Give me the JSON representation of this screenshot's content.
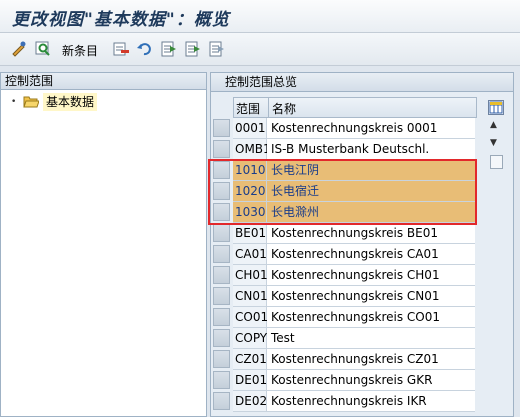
{
  "title": "更改视图\"基本数据\"：概览",
  "toolbar": {
    "new_entries_label": "新条目",
    "icons": [
      "display-change-icon",
      "find-icon",
      "copy-icon",
      "delete-icon",
      "undo-icon",
      "select-all-icon",
      "select-block-icon",
      "deselect-all-icon"
    ]
  },
  "left_pane": {
    "header": "控制范围",
    "tree_item": "基本数据"
  },
  "right_pane": {
    "header": "控制范围总览",
    "columns": [
      "范围",
      "名称"
    ],
    "rows": [
      {
        "code": "0001",
        "name": "Kostenrechnungskreis 0001"
      },
      {
        "code": "OMB1",
        "name": "IS-B Musterbank Deutschl."
      },
      {
        "code": "1010",
        "name": "长电江阴"
      },
      {
        "code": "1020",
        "name": "长电宿迁"
      },
      {
        "code": "1030",
        "name": "长电滁州"
      },
      {
        "code": "BE01",
        "name": "Kostenrechnungskreis BE01"
      },
      {
        "code": "CA01",
        "name": "Kostenrechnungskreis CA01"
      },
      {
        "code": "CH01",
        "name": "Kostenrechnungskreis CH01"
      },
      {
        "code": "CN01",
        "name": "Kostenrechnungskreis CN01"
      },
      {
        "code": "CO01",
        "name": "Kostenrechnungskreis CO01"
      },
      {
        "code": "COPY",
        "name": "Test"
      },
      {
        "code": "CZ01",
        "name": "Kostenrechnungskreis CZ01"
      },
      {
        "code": "DE01",
        "name": "Kostenrechnungskreis GKR"
      },
      {
        "code": "DE02",
        "name": "Kostenrechnungskreis IKR"
      }
    ]
  },
  "colors": {
    "highlight_row": "#e8bd76",
    "highlight_border": "#e2282b"
  }
}
